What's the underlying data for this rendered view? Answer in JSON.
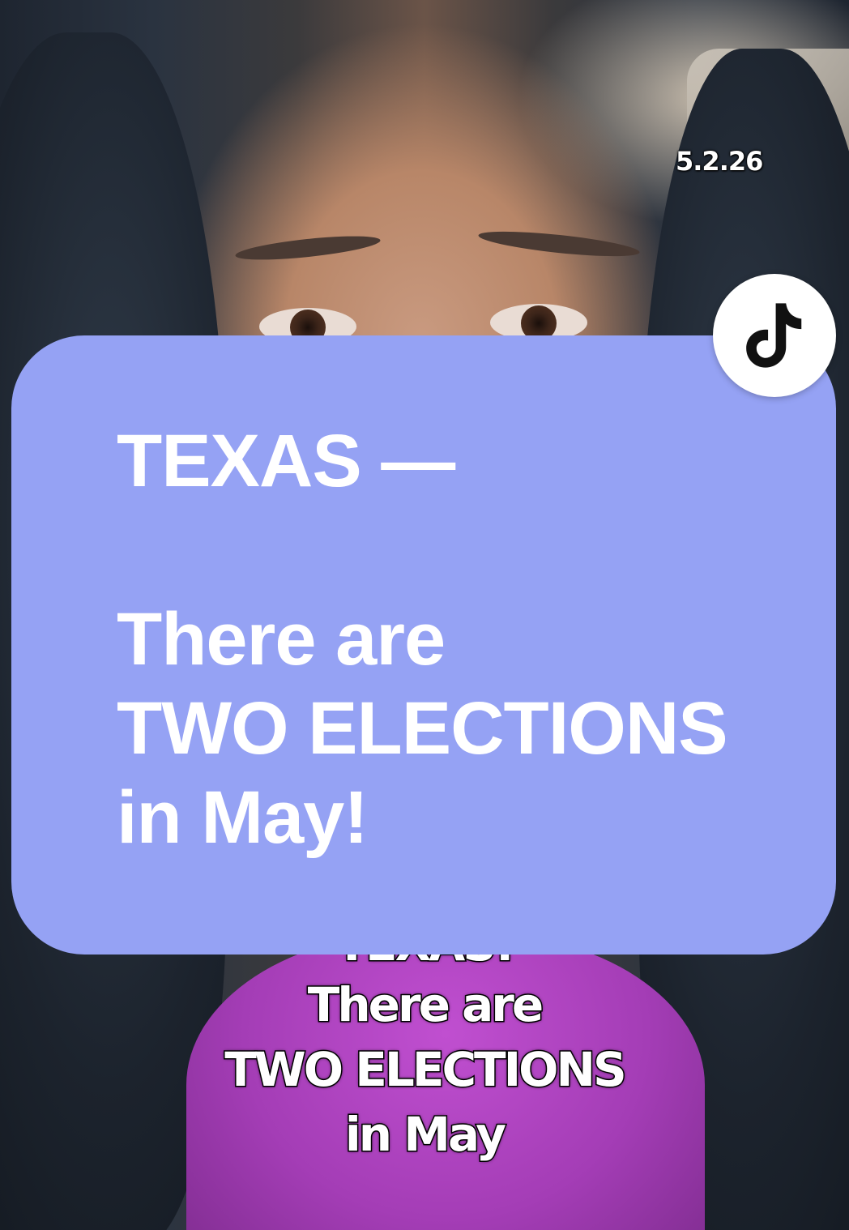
{
  "overlay_card": {
    "lines": [
      "TEXAS —",
      "There are",
      "TWO ELECTIONS",
      "in May!"
    ],
    "background_color": "#95a2f4",
    "text_color": "#ffffff"
  },
  "video": {
    "date_stamp": "5.2.26",
    "burned_caption": {
      "lines": [
        "TEXAS!",
        "There are",
        "TWO ELECTIONS",
        "in May"
      ]
    }
  },
  "app_badge": {
    "icon": "tiktok-logo-icon"
  }
}
